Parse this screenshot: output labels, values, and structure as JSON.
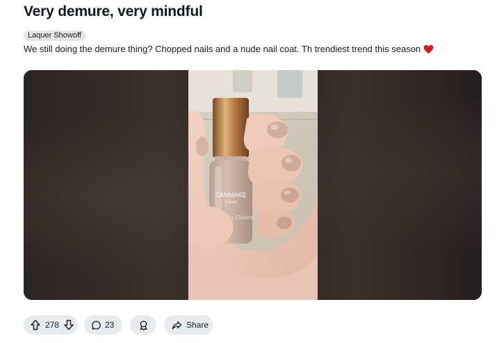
{
  "post": {
    "title": "Very demure, very mindful",
    "flair": "Laquer Showoff",
    "body": "We still doing the demure thing? Chopped nails and a nude nail coat. Th trendiest trend this season",
    "image": {
      "bottle_brand": "CANMAKE",
      "bottle_sub": "TOKYO",
      "bottle_script": "Fiberless Colors"
    }
  },
  "actions": {
    "upvotes": "278",
    "comments": "23",
    "share_label": "Share"
  },
  "colors": {
    "pill_bg": "#e5ebee",
    "heart": "#d7192a",
    "polish": "#c9ad9f"
  },
  "icons": [
    "upvote-icon",
    "downvote-icon",
    "comment-icon",
    "award-icon",
    "share-icon",
    "heart-icon"
  ]
}
